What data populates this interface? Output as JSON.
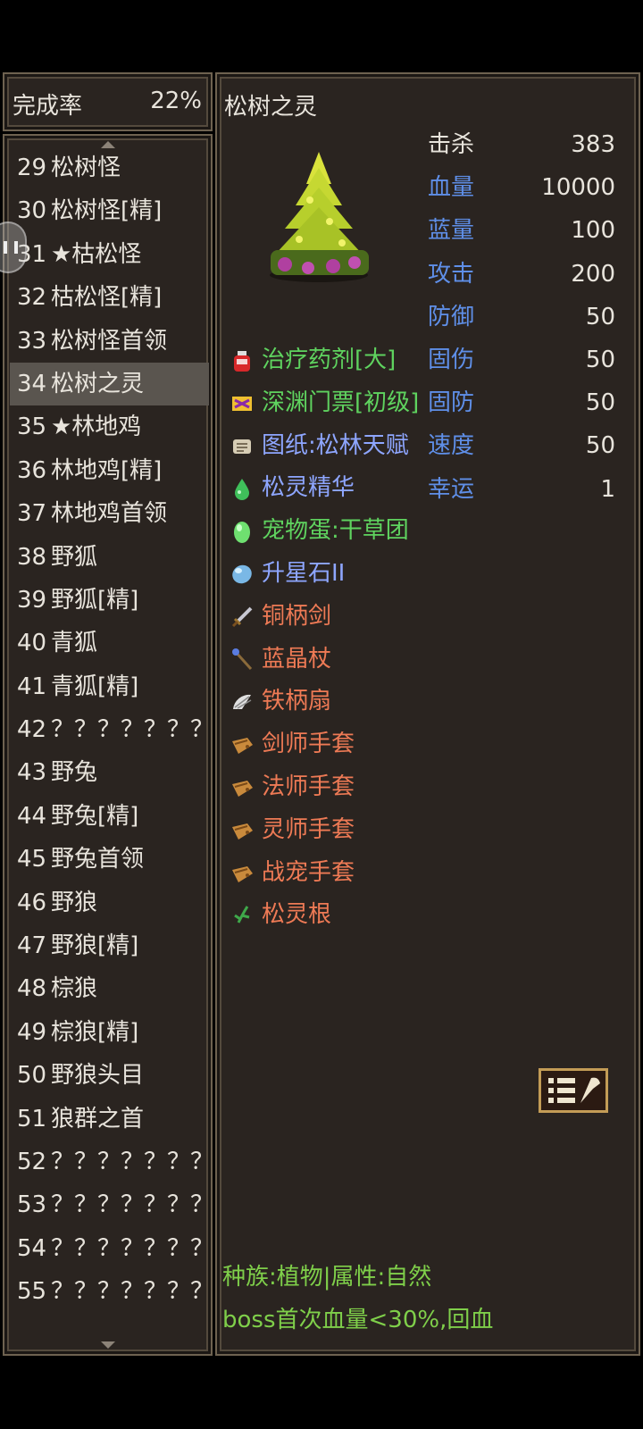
{
  "completion": {
    "label": "完成率",
    "value": "22%"
  },
  "monster_list": [
    {
      "num": "29",
      "name": "松树怪"
    },
    {
      "num": "30",
      "name": "松树怪[精]"
    },
    {
      "num": "31",
      "name": "★枯松怪"
    },
    {
      "num": "32",
      "name": "枯松怪[精]"
    },
    {
      "num": "33",
      "name": "松树怪首领"
    },
    {
      "num": "34",
      "name": "松树之灵",
      "selected": true
    },
    {
      "num": "35",
      "name": "★林地鸡"
    },
    {
      "num": "36",
      "name": "林地鸡[精]"
    },
    {
      "num": "37",
      "name": "林地鸡首领"
    },
    {
      "num": "38",
      "name": "野狐"
    },
    {
      "num": "39",
      "name": "野狐[精]"
    },
    {
      "num": "40",
      "name": "青狐"
    },
    {
      "num": "41",
      "name": "青狐[精]"
    },
    {
      "num": "42",
      "name": "？？？？？？？"
    },
    {
      "num": "43",
      "name": "野兔"
    },
    {
      "num": "44",
      "name": "野兔[精]"
    },
    {
      "num": "45",
      "name": "野兔首领"
    },
    {
      "num": "46",
      "name": "野狼"
    },
    {
      "num": "47",
      "name": "野狼[精]"
    },
    {
      "num": "48",
      "name": "棕狼"
    },
    {
      "num": "49",
      "name": "棕狼[精]"
    },
    {
      "num": "50",
      "name": "野狼头目"
    },
    {
      "num": "51",
      "name": "狼群之首"
    },
    {
      "num": "52",
      "name": "？？？？？？？"
    },
    {
      "num": "53",
      "name": "？？？？？？？"
    },
    {
      "num": "54",
      "name": "？？？？？？？"
    },
    {
      "num": "55",
      "name": "？？？？？？？"
    }
  ],
  "detail": {
    "name": "松树之灵",
    "stats": [
      {
        "label": "击杀",
        "value": "383",
        "highlight": false
      },
      {
        "label": "血量",
        "value": "10000",
        "highlight": true
      },
      {
        "label": "蓝量",
        "value": "100",
        "highlight": true
      },
      {
        "label": "攻击",
        "value": "200",
        "highlight": true
      },
      {
        "label": "防御",
        "value": "50",
        "highlight": true
      },
      {
        "label": "固伤",
        "value": "50",
        "highlight": true
      },
      {
        "label": "固防",
        "value": "50",
        "highlight": true
      },
      {
        "label": "速度",
        "value": "50",
        "highlight": true
      },
      {
        "label": "幸运",
        "value": "1",
        "highlight": true
      }
    ],
    "drops": [
      {
        "name": "治疗药剂[大]",
        "color": "green",
        "icon": "potion-icon"
      },
      {
        "name": "深渊门票[初级]",
        "color": "green",
        "icon": "ticket-icon"
      },
      {
        "name": "图纸:松林天赋",
        "color": "blue",
        "icon": "scroll-icon"
      },
      {
        "name": "松灵精华",
        "color": "blue",
        "icon": "essence-icon"
      },
      {
        "name": "宠物蛋:干草团",
        "color": "green",
        "icon": "egg-icon"
      },
      {
        "name": "升星石II",
        "color": "blue",
        "icon": "gem-icon"
      },
      {
        "name": "铜柄剑",
        "color": "orange",
        "icon": "sword-icon"
      },
      {
        "name": "蓝晶杖",
        "color": "orange",
        "icon": "staff-icon"
      },
      {
        "name": "铁柄扇",
        "color": "orange",
        "icon": "fan-icon"
      },
      {
        "name": "剑师手套",
        "color": "orange",
        "icon": "glove-icon"
      },
      {
        "name": "法师手套",
        "color": "orange",
        "icon": "glove-icon"
      },
      {
        "name": "灵师手套",
        "color": "orange",
        "icon": "glove-icon"
      },
      {
        "name": "战宠手套",
        "color": "orange",
        "icon": "glove-icon"
      },
      {
        "name": "松灵根",
        "color": "orange",
        "icon": "root-icon"
      }
    ],
    "race_line": "种族:植物|属性:自然",
    "trait_line": "boss首次血量<30%,回血"
  },
  "colors": {
    "panel_bg": "#2a2420",
    "border": "#6e6250",
    "stat_label_blue": "#5f8fe8",
    "drop_green": "#5fd35f",
    "drop_blue": "#8ea6ff",
    "drop_orange": "#ee7a55",
    "footer_green": "#7fcf4a"
  }
}
